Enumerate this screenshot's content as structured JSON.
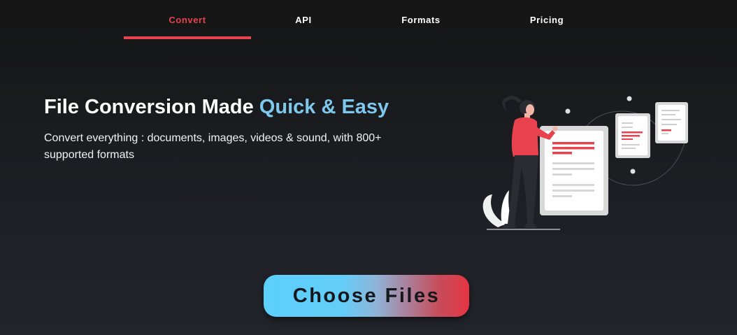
{
  "nav": {
    "items": [
      {
        "label": "Convert",
        "active": true
      },
      {
        "label": "API",
        "active": false
      },
      {
        "label": "Formats",
        "active": false
      },
      {
        "label": "Pricing",
        "active": false
      }
    ]
  },
  "hero": {
    "title_main": "File Conversion Made ",
    "title_accent": "Quick & Easy",
    "subtitle": "Convert everything : documents, images, videos & sound, with 800+ supported formats",
    "illustration_icon": "woman-with-documents-illustration"
  },
  "cta": {
    "label": "Choose Files"
  },
  "colors": {
    "accent_red": "#e8424f",
    "accent_blue": "#7ec8ee",
    "background": "#1b1d21"
  }
}
